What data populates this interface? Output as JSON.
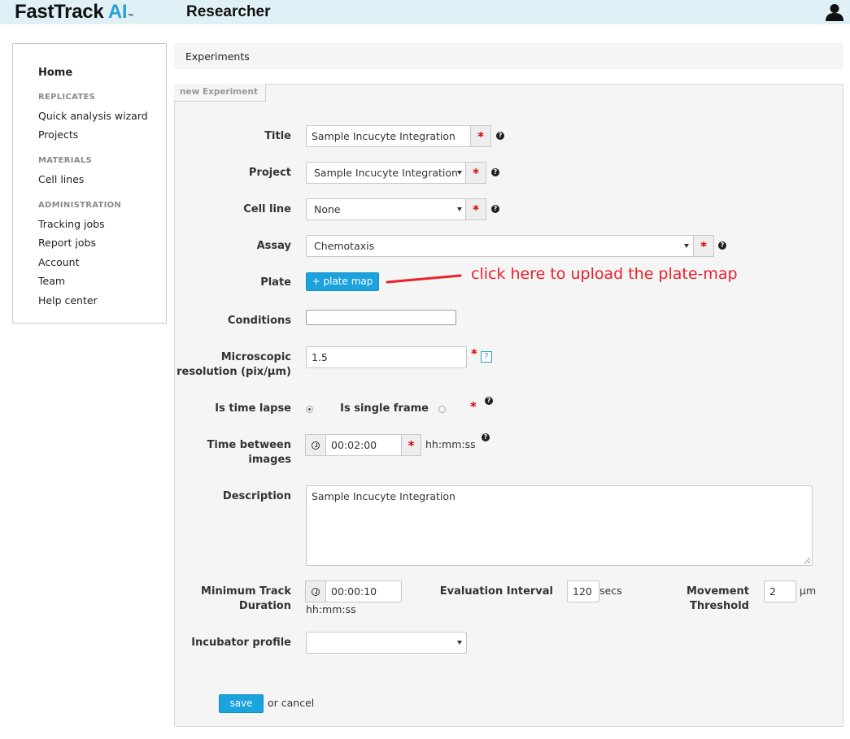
{
  "header": {
    "logo_a": "FastTrack ",
    "logo_b": "AI",
    "logo_tm": "™",
    "role": "Researcher",
    "user_icon": "user-icon"
  },
  "sidebar": {
    "home": "Home",
    "replicates_heading": "REPLICATES",
    "quick_analysis": "Quick analysis wizard",
    "projects": "Projects",
    "materials_heading": "MATERIALS",
    "cell_lines": "Cell lines",
    "administration_heading": "ADMINISTRATION",
    "tracking_jobs": "Tracking jobs",
    "report_jobs": "Report jobs",
    "account": "Account",
    "team": "Team",
    "help_center": "Help center"
  },
  "breadcrumb": "Experiments",
  "form": {
    "legend": "new Experiment",
    "title_label": "Title",
    "title_value": "Sample Incucyte Integration",
    "project_label": "Project",
    "project_value": "Sample Incucyte Integration",
    "cell_line_label": "Cell line",
    "cell_line_value": "None",
    "assay_label": "Assay",
    "assay_value": "Chemotaxis",
    "plate_label": "Plate",
    "plate_button": "+ plate map",
    "annotation": "click here to upload the plate-map",
    "conditions_label": "Conditions",
    "conditions_value": "",
    "resolution_label_1": "Microscopic",
    "resolution_label_2": "resolution (pix/µm)",
    "resolution_value": "1.5",
    "resolution_help": "?",
    "time_lapse_label": "Is time lapse",
    "single_frame_label": "Is single frame",
    "time_between_label_1": "Time between",
    "time_between_label_2": "images",
    "time_between_value": "00:02:00",
    "time_format": "hh:mm:ss",
    "description_label": "Description",
    "description_value": "Sample Incucyte Integration",
    "min_track_label_1": "Minimum Track",
    "min_track_label_2": "Duration",
    "min_track_value": "00:00:10",
    "min_track_format": "hh:mm:ss",
    "eval_interval_label": "Evaluation Interval",
    "eval_interval_value": "120",
    "eval_interval_unit": "secs",
    "movement_label_1": "Movement",
    "movement_label_2": "Threshold",
    "movement_value": "2",
    "movement_unit": "µm",
    "incubator_label": "Incubator profile",
    "incubator_value": "",
    "required_mark": "*",
    "help_mark": "?",
    "save_button": "save",
    "or_cancel": "or cancel"
  },
  "colors": {
    "accent": "#29a0cd",
    "header_bg": "#dff0f7",
    "annotation": "#e8232a",
    "required": "#d40000"
  }
}
